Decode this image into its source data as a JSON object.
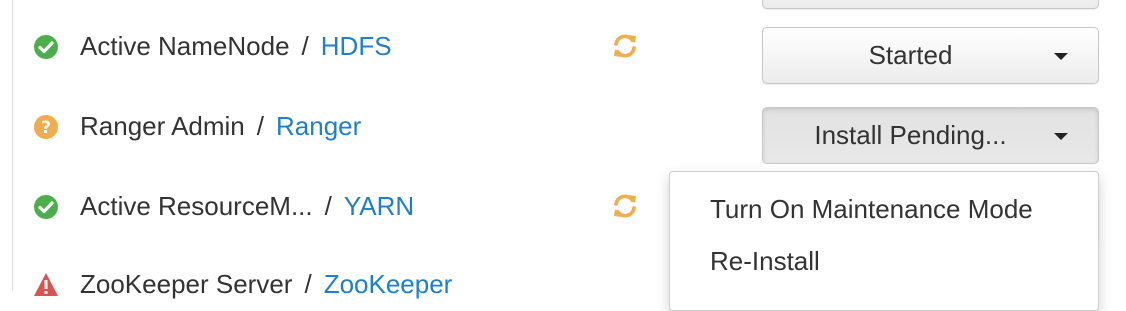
{
  "rows": [
    {
      "component": "Active NameNode",
      "separator": "/",
      "service": "HDFS",
      "status": "started",
      "status_icon": "check-circle-icon",
      "status_color": "#4cae4c",
      "show_refresh": true
    },
    {
      "component": "Ranger Admin",
      "separator": "/",
      "service": "Ranger",
      "status": "install-pending",
      "status_icon": "question-circle-icon",
      "status_color": "#f0ad4e",
      "show_refresh": false
    },
    {
      "component": "Active ResourceM...",
      "separator": "/",
      "service": "YARN",
      "status": "started",
      "status_icon": "check-circle-icon",
      "status_color": "#4cae4c",
      "show_refresh": true
    },
    {
      "component": "ZooKeeper Server",
      "separator": "/",
      "service": "ZooKeeper",
      "status": "alert",
      "status_icon": "warning-triangle-icon",
      "status_color": "#d9534f",
      "show_refresh": false
    }
  ],
  "buttons": {
    "namenode_action": "Started",
    "ranger_action": "Install Pending..."
  },
  "dropdown": {
    "items": [
      "Turn On Maintenance Mode",
      "Re-Install"
    ]
  },
  "colors": {
    "link": "#1f7fc8",
    "refresh": "#f0ad4e"
  }
}
